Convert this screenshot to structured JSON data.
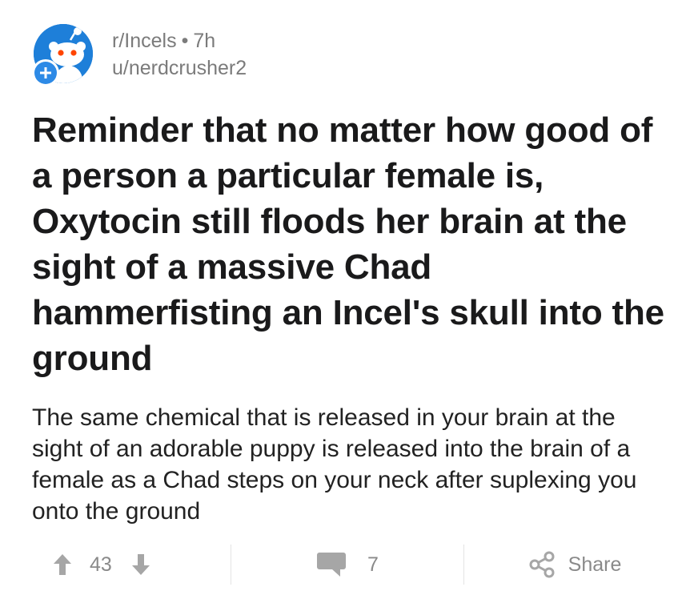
{
  "header": {
    "subreddit": "r/Incels",
    "separator": "•",
    "time": "7h",
    "username": "u/nerdcrusher2",
    "avatar_icon": "reddit-snoo-avatar-icon",
    "badge_icon": "plus-icon"
  },
  "post": {
    "title": "Reminder that no matter how good of a person a particular female is, Oxytocin still floods her brain at the sight of a massive Chad hammerfisting an Incel's skull into the ground",
    "body": "The same chemical that is released in your brain at the sight of an adorable puppy is released into the brain of a female as a Chad steps on your neck after suplexing you onto the ground"
  },
  "actions": {
    "vote_count": "43",
    "comment_count": "7",
    "share_label": "Share",
    "upvote_icon": "arrow-up-icon",
    "downvote_icon": "arrow-down-icon",
    "comment_icon": "speech-bubble-icon",
    "share_icon": "share-icon"
  },
  "colors": {
    "avatar_blue": "#1e7fd9",
    "badge_blue": "#2d8ae6",
    "text_dark": "#1a1a1b",
    "text_gray": "#7b7b7b",
    "icon_gray": "#a6a6a6"
  }
}
